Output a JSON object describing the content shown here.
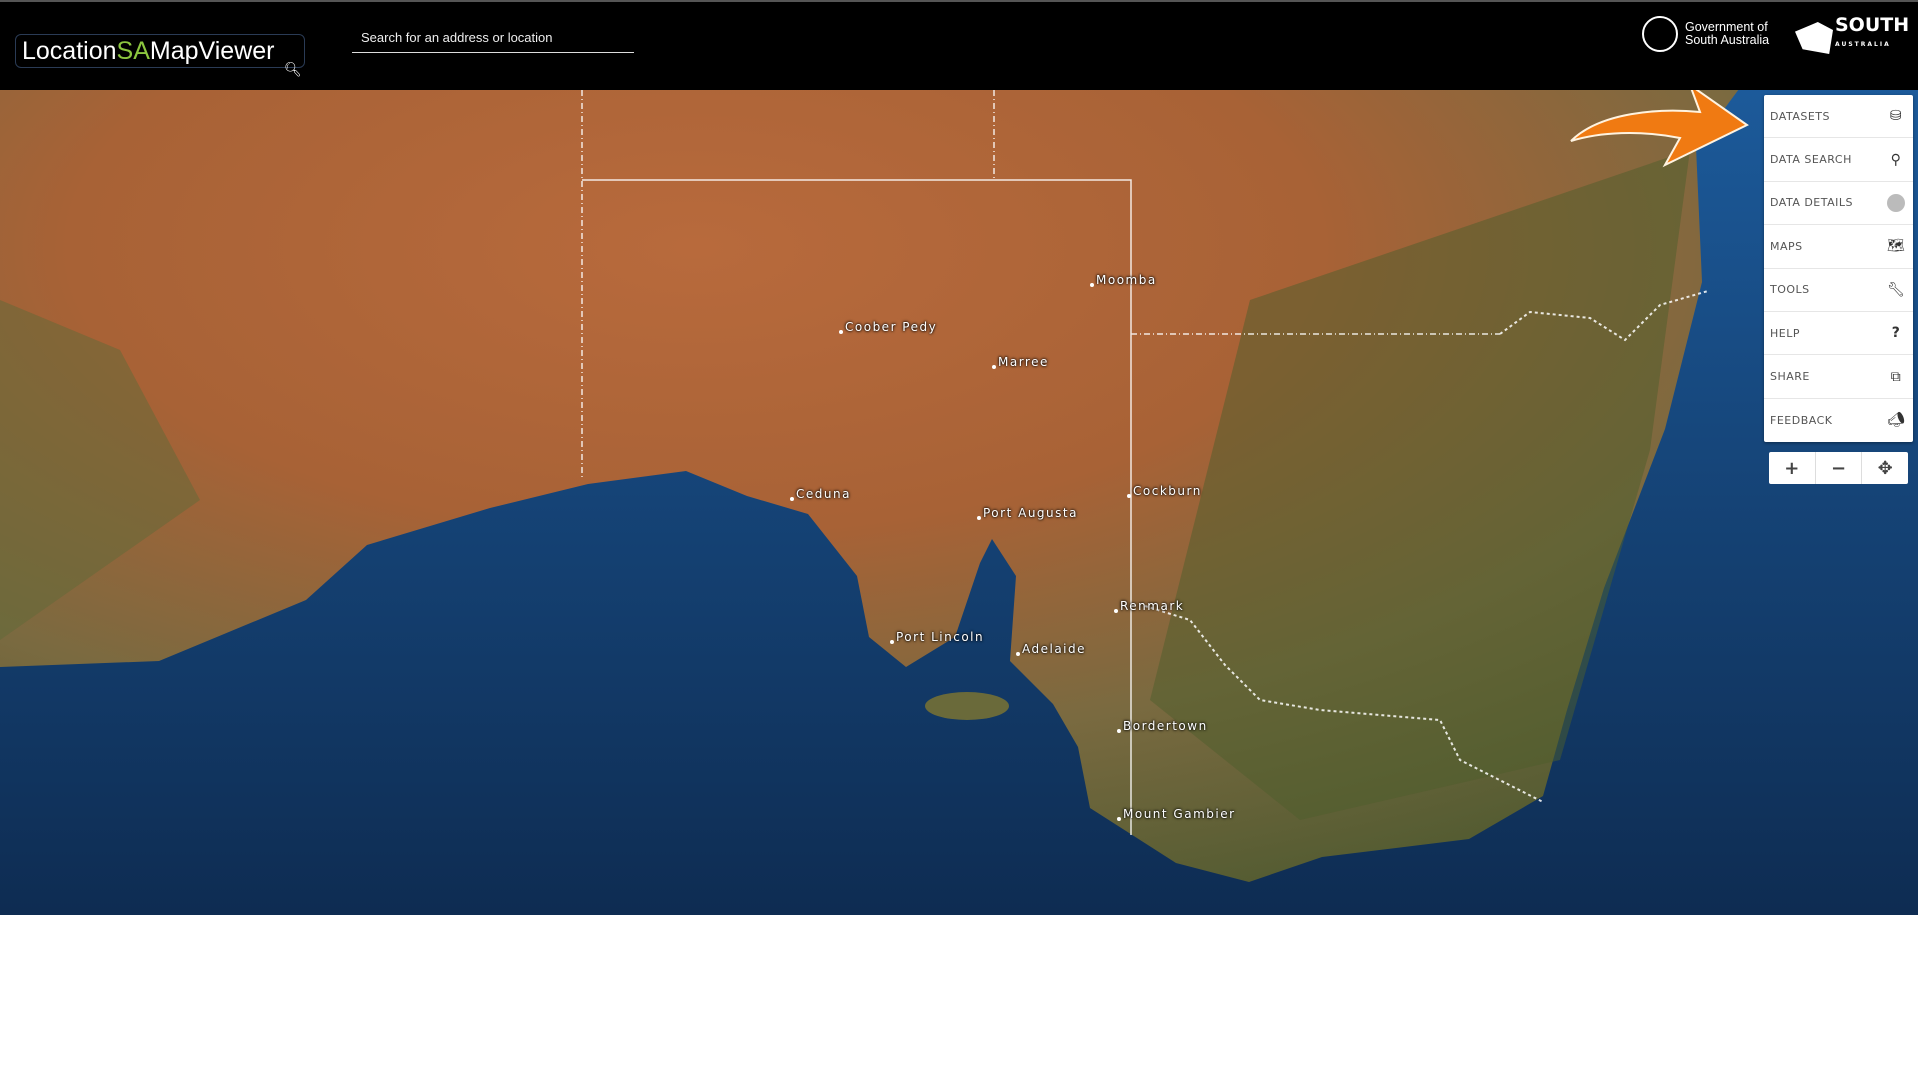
{
  "header": {
    "logo": {
      "part1": "Location",
      "part2": "SA",
      "part3": "MapViewer"
    },
    "search_placeholder": "Search for an address or location",
    "gov_line1": "Government of",
    "gov_line2": "South Australia",
    "brand_word": "SOUTH",
    "brand_sub": "AUSTRALIA"
  },
  "panel": {
    "items": [
      {
        "label": "DATASETS",
        "icon": "database-icon"
      },
      {
        "label": "DATA SEARCH",
        "icon": "search-icon"
      },
      {
        "label": "DATA DETAILS",
        "icon": "info-circle-icon"
      },
      {
        "label": "MAPS",
        "icon": "map-icon"
      },
      {
        "label": "TOOLS",
        "icon": "wrench-icon"
      },
      {
        "label": "HELP",
        "icon": "question-icon"
      },
      {
        "label": "SHARE",
        "icon": "share-icon"
      },
      {
        "label": "FEEDBACK",
        "icon": "megaphone-icon"
      }
    ]
  },
  "zoom": {
    "in": "+",
    "out": "−",
    "locate": "✥"
  },
  "places": [
    "Moomba",
    "Coober Pedy",
    "Marree",
    "Ceduna",
    "Port Augusta",
    "Cockburn",
    "Renmark",
    "Port Lincoln",
    "Adelaide",
    "Bordertown",
    "Mount Gambier"
  ],
  "colors": {
    "header": "#000000",
    "accent_green": "#8cc63f",
    "arrow": "#f07a12",
    "ocean": "#163a66"
  }
}
